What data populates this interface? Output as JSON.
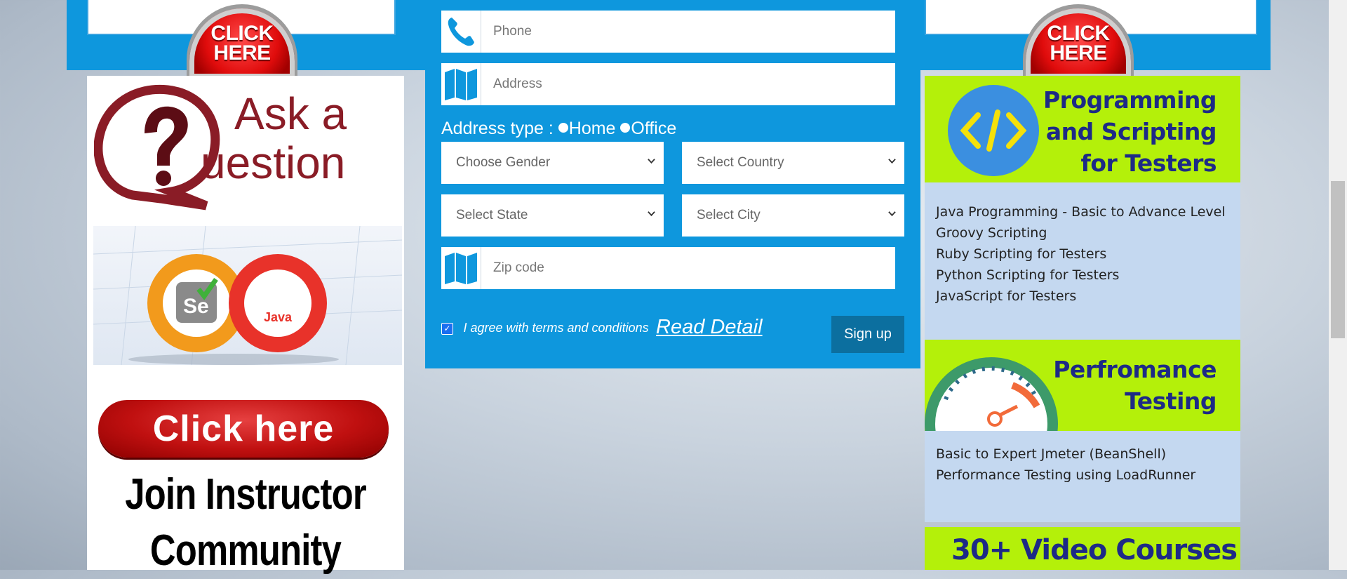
{
  "banner": {
    "left_click_label_1": "CLICK",
    "left_click_label_2": "HERE",
    "right_click_label_1": "CLICK",
    "right_click_label_2": "HERE"
  },
  "form": {
    "phone_placeholder": "Phone",
    "address_placeholder": "Address",
    "address_type_label": "Address type :",
    "address_type_options": [
      "Home",
      "Office"
    ],
    "gender_select": "Choose Gender",
    "country_select": "Select Country",
    "state_select": "Select State",
    "city_select": "Select City",
    "zip_placeholder": "Zip code",
    "terms_text": "I agree with terms and conditions",
    "terms_checked": true,
    "read_detail_link": "Read Detail",
    "signup_button": "Sign up",
    "panel_color": "#0e97dd",
    "signup_color": "#0c6f9f"
  },
  "left_sidebar": {
    "ask_line1": "Ask a",
    "ask_line2": "uestion",
    "selenium_badge": "Se",
    "java_badge": "Java",
    "click_here": "Click here",
    "join_line1": "Join Instructor",
    "join_line2": "Community"
  },
  "right_sidebar": {
    "programming": {
      "title_lines": [
        "Programming",
        "and Scripting",
        "for Testers"
      ],
      "icon_text": "</>",
      "courses": [
        "Java Programming - Basic to Advance Level",
        "Groovy Scripting",
        "Ruby Scripting for Testers",
        "Python Scripting for Testers",
        "JavaScript for Testers"
      ]
    },
    "performance": {
      "title_lines": [
        "Perfromance",
        "Testing"
      ],
      "gauge_min": "0",
      "gauge_max": "100",
      "courses": [
        "Basic to Expert Jmeter (BeanShell)",
        "Performance Testing using LoadRunner"
      ]
    },
    "video_courses": "30+ Video Courses"
  }
}
